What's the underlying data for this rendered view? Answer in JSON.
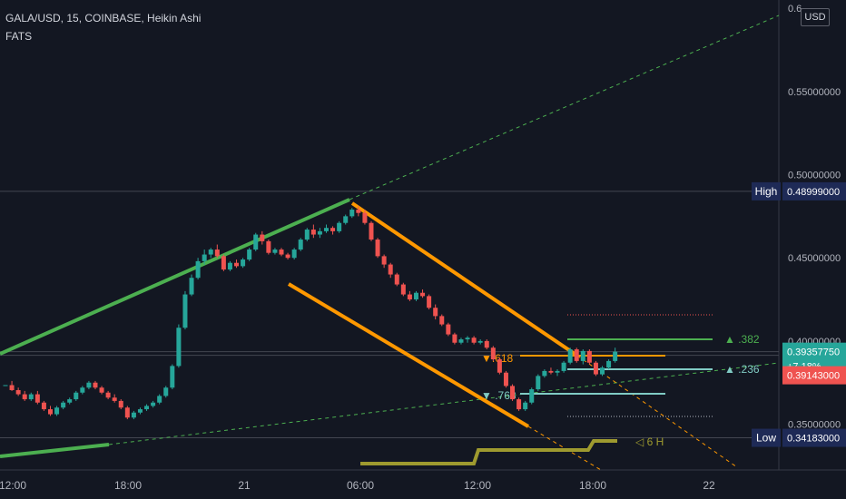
{
  "header": {
    "title": "GALA/USD, 15, COINBASE, Heikin Ashi",
    "indicator": "FATS"
  },
  "currency_badge": "USD",
  "markers": {
    "high": {
      "label": "High",
      "value": "0.48999000",
      "color": "#1e2a56"
    },
    "low": {
      "label": "Low",
      "value": "0.34183000",
      "color": "#1e2a56"
    },
    "last_price": {
      "value": "0.39357750",
      "change": "+7.18%",
      "color": "#26a69a"
    },
    "sell_price": {
      "value": "0.39143000",
      "color": "#ef5350"
    }
  },
  "fib_labels": {
    "f382": "▲ .382",
    "f236": "▲ .236",
    "f618": "▼.618",
    "f768": "▼ .768"
  },
  "timeframe_label": "◁ 6 H",
  "colors": {
    "bg": "#131722",
    "up": "#26a69a",
    "down": "#ef5350",
    "green_line": "#4caf50",
    "orange_line": "#ff9800",
    "olive": "#9e9a2f",
    "teal_line": "#80cbc4",
    "grid": "#363a45"
  },
  "chart_data": {
    "type": "candlestick",
    "title": "GALA/USD, 15, COINBASE, Heikin Ashi",
    "ylim": [
      0.3225,
      0.605
    ],
    "y_ticks": [
      "0.35000000",
      "0.40000000",
      "0.45000000",
      "0.50000000",
      "0.55000000",
      "0.6"
    ],
    "x_ticks": [
      "12:00",
      "18:00",
      "21",
      "06:00",
      "12:00",
      "18:00",
      "22"
    ],
    "price_lines": {
      "high": 0.48999,
      "low": 0.34183,
      "last": 0.3935775,
      "sell": 0.39143
    },
    "fib_levels": {
      "0.382": 0.404,
      "0.236": 0.3873,
      "0.618": 0.3944,
      "0.768": 0.3801
    },
    "series": [
      {
        "name": "GALA/USD",
        "values": [
          [
            0.3735,
            0.3735,
            0.3735,
            0.3735
          ],
          [
            0.3735,
            0.376,
            0.37,
            0.3705
          ],
          [
            0.3705,
            0.372,
            0.367,
            0.368
          ],
          [
            0.368,
            0.37,
            0.364,
            0.365
          ],
          [
            0.365,
            0.369,
            0.364,
            0.368
          ],
          [
            0.368,
            0.37,
            0.362,
            0.363
          ],
          [
            0.363,
            0.364,
            0.358,
            0.359
          ],
          [
            0.359,
            0.361,
            0.355,
            0.356
          ],
          [
            0.356,
            0.361,
            0.355,
            0.36
          ],
          [
            0.36,
            0.364,
            0.359,
            0.363
          ],
          [
            0.363,
            0.366,
            0.362,
            0.365
          ],
          [
            0.365,
            0.37,
            0.364,
            0.369
          ],
          [
            0.369,
            0.373,
            0.368,
            0.372
          ],
          [
            0.372,
            0.376,
            0.371,
            0.375
          ],
          [
            0.375,
            0.376,
            0.371,
            0.372
          ],
          [
            0.372,
            0.373,
            0.368,
            0.369
          ],
          [
            0.369,
            0.37,
            0.365,
            0.366
          ],
          [
            0.366,
            0.368,
            0.363,
            0.364
          ],
          [
            0.364,
            0.365,
            0.359,
            0.36
          ],
          [
            0.36,
            0.361,
            0.353,
            0.354
          ],
          [
            0.354,
            0.358,
            0.353,
            0.357
          ],
          [
            0.357,
            0.36,
            0.356,
            0.359
          ],
          [
            0.359,
            0.362,
            0.358,
            0.361
          ],
          [
            0.361,
            0.364,
            0.36,
            0.363
          ],
          [
            0.363,
            0.368,
            0.362,
            0.367
          ],
          [
            0.367,
            0.373,
            0.366,
            0.372
          ],
          [
            0.372,
            0.386,
            0.371,
            0.385
          ],
          [
            0.385,
            0.41,
            0.384,
            0.408
          ],
          [
            0.408,
            0.43,
            0.407,
            0.428
          ],
          [
            0.428,
            0.44,
            0.427,
            0.438
          ],
          [
            0.438,
            0.45,
            0.437,
            0.448
          ],
          [
            0.448,
            0.455,
            0.446,
            0.452
          ],
          [
            0.452,
            0.456,
            0.45,
            0.455
          ],
          [
            0.455,
            0.458,
            0.45,
            0.451
          ],
          [
            0.451,
            0.452,
            0.442,
            0.443
          ],
          [
            0.443,
            0.448,
            0.442,
            0.447
          ],
          [
            0.447,
            0.449,
            0.444,
            0.445
          ],
          [
            0.445,
            0.45,
            0.444,
            0.449
          ],
          [
            0.449,
            0.456,
            0.448,
            0.455
          ],
          [
            0.455,
            0.465,
            0.454,
            0.464
          ],
          [
            0.464,
            0.466,
            0.458,
            0.46
          ],
          [
            0.46,
            0.461,
            0.452,
            0.453
          ],
          [
            0.453,
            0.456,
            0.452,
            0.455
          ],
          [
            0.455,
            0.456,
            0.451,
            0.452
          ],
          [
            0.452,
            0.453,
            0.449,
            0.45
          ],
          [
            0.45,
            0.456,
            0.449,
            0.455
          ],
          [
            0.455,
            0.462,
            0.454,
            0.461
          ],
          [
            0.461,
            0.468,
            0.46,
            0.467
          ],
          [
            0.467,
            0.47,
            0.462,
            0.464
          ],
          [
            0.464,
            0.468,
            0.462,
            0.466
          ],
          [
            0.466,
            0.47,
            0.465,
            0.468
          ],
          [
            0.468,
            0.469,
            0.464,
            0.466
          ],
          [
            0.466,
            0.472,
            0.465,
            0.471
          ],
          [
            0.471,
            0.476,
            0.47,
            0.475
          ],
          [
            0.475,
            0.48,
            0.474,
            0.479
          ],
          [
            0.479,
            0.481,
            0.475,
            0.477
          ],
          [
            0.477,
            0.479,
            0.47,
            0.471
          ],
          [
            0.471,
            0.472,
            0.46,
            0.461
          ],
          [
            0.461,
            0.462,
            0.45,
            0.451
          ],
          [
            0.451,
            0.452,
            0.444,
            0.446
          ],
          [
            0.446,
            0.447,
            0.438,
            0.44
          ],
          [
            0.44,
            0.441,
            0.433,
            0.434
          ],
          [
            0.434,
            0.435,
            0.427,
            0.428
          ],
          [
            0.428,
            0.43,
            0.424,
            0.425
          ],
          [
            0.425,
            0.43,
            0.424,
            0.429
          ],
          [
            0.429,
            0.431,
            0.426,
            0.427
          ],
          [
            0.427,
            0.428,
            0.419,
            0.42
          ],
          [
            0.42,
            0.422,
            0.413,
            0.415
          ],
          [
            0.415,
            0.416,
            0.409,
            0.41
          ],
          [
            0.41,
            0.411,
            0.403,
            0.404
          ],
          [
            0.404,
            0.405,
            0.398,
            0.399
          ],
          [
            0.399,
            0.402,
            0.398,
            0.401
          ],
          [
            0.401,
            0.403,
            0.399,
            0.402
          ],
          [
            0.402,
            0.403,
            0.398,
            0.399
          ],
          [
            0.399,
            0.401,
            0.398,
            0.4
          ],
          [
            0.4,
            0.401,
            0.395,
            0.396
          ],
          [
            0.396,
            0.397,
            0.388,
            0.389
          ],
          [
            0.389,
            0.39,
            0.38,
            0.381
          ],
          [
            0.381,
            0.382,
            0.372,
            0.373
          ],
          [
            0.373,
            0.374,
            0.364,
            0.365
          ],
          [
            0.365,
            0.366,
            0.358,
            0.359
          ],
          [
            0.359,
            0.364,
            0.358,
            0.363
          ],
          [
            0.363,
            0.372,
            0.362,
            0.371
          ],
          [
            0.371,
            0.38,
            0.37,
            0.379
          ],
          [
            0.379,
            0.383,
            0.378,
            0.382
          ],
          [
            0.382,
            0.384,
            0.38,
            0.381
          ],
          [
            0.381,
            0.383,
            0.379,
            0.382
          ],
          [
            0.382,
            0.388,
            0.381,
            0.387
          ],
          [
            0.387,
            0.396,
            0.386,
            0.395
          ],
          [
            0.395,
            0.396,
            0.387,
            0.388
          ],
          [
            0.388,
            0.395,
            0.386,
            0.394
          ],
          [
            0.394,
            0.395,
            0.386,
            0.387
          ],
          [
            0.387,
            0.388,
            0.379,
            0.38
          ],
          [
            0.38,
            0.385,
            0.379,
            0.384
          ],
          [
            0.384,
            0.389,
            0.383,
            0.388
          ],
          [
            0.388,
            0.396,
            0.387,
            0.3936
          ]
        ]
      }
    ]
  }
}
